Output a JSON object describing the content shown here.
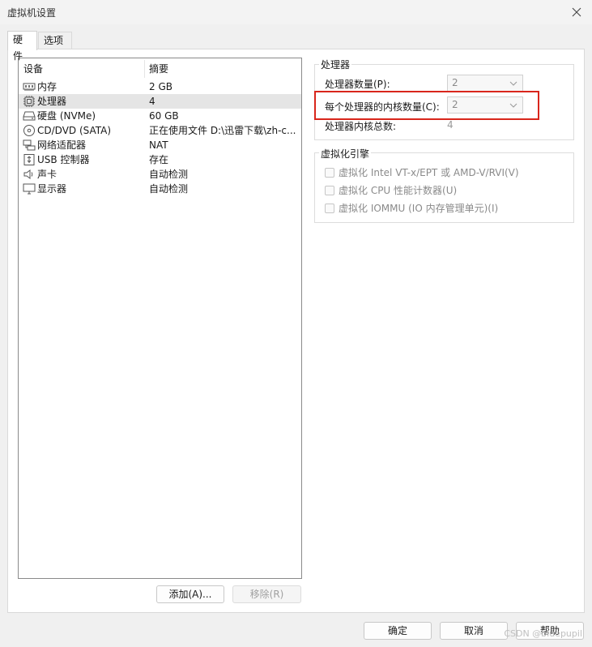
{
  "window": {
    "title": "虚拟机设置"
  },
  "tabs": [
    {
      "label": "硬件"
    },
    {
      "label": "选项"
    }
  ],
  "device_list": {
    "headers": {
      "device": "设备",
      "summary": "摘要"
    },
    "rows": [
      {
        "name": "内存",
        "summary": "2 GB",
        "icon": "memory-icon"
      },
      {
        "name": "处理器",
        "summary": "4",
        "icon": "processor-icon",
        "selected": true
      },
      {
        "name": "硬盘 (NVMe)",
        "summary": "60 GB",
        "icon": "hard-disk-icon"
      },
      {
        "name": "CD/DVD (SATA)",
        "summary": "正在使用文件 D:\\迅雷下载\\zh-c...",
        "icon": "cd-dvd-icon"
      },
      {
        "name": "网络适配器",
        "summary": "NAT",
        "icon": "network-adapter-icon"
      },
      {
        "name": "USB 控制器",
        "summary": "存在",
        "icon": "usb-controller-icon"
      },
      {
        "name": "声卡",
        "summary": "自动检测",
        "icon": "sound-card-icon"
      },
      {
        "name": "显示器",
        "summary": "自动检测",
        "icon": "display-icon"
      }
    ]
  },
  "list_buttons": {
    "add": "添加(A)...",
    "remove": "移除(R)"
  },
  "processor_group": {
    "title": "处理器",
    "count_label": "处理器数量(P):",
    "count_value": "2",
    "cores_label": "每个处理器的内核数量(C):",
    "cores_value": "2",
    "total_label": "处理器内核总数:",
    "total_value": "4"
  },
  "virtualization_group": {
    "title": "虚拟化引擎",
    "options": [
      "虚拟化 Intel VT-x/EPT 或 AMD-V/RVI(V)",
      "虚拟化 CPU 性能计数器(U)",
      "虚拟化 IOMMU (IO 内存管理单元)(I)"
    ]
  },
  "footer": {
    "ok": "确定",
    "cancel": "取消",
    "help": "帮助"
  },
  "watermark": "CSDN @bluepupil",
  "colors": {
    "highlight": "#d9261c",
    "selected_row": "#e5e5e5"
  }
}
